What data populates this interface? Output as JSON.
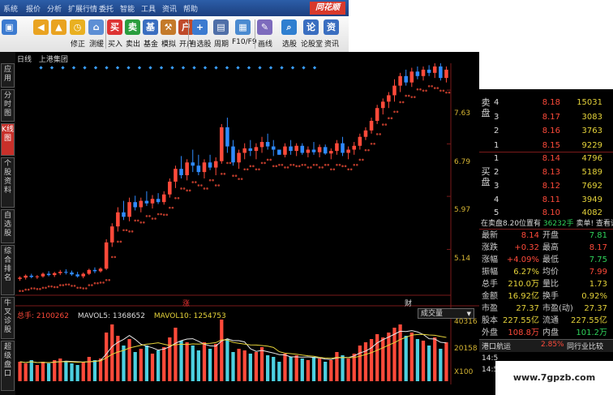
{
  "menubar": {
    "items": [
      "系统",
      "报价",
      "分析",
      "扩展行情",
      "委托",
      "智能",
      "工具",
      "资讯",
      "帮助"
    ],
    "brand": "同花顺"
  },
  "toolbar": {
    "buttons": [
      {
        "label": "",
        "icon": "back-icon"
      },
      {
        "label": "",
        "icon": "up-icon"
      },
      {
        "label": "修正",
        "icon": "fix-icon"
      },
      {
        "label": "测缓",
        "icon": "measure-icon"
      },
      {
        "label": "买入",
        "icon": "buy-icon"
      },
      {
        "label": "卖出",
        "icon": "sell-icon"
      },
      {
        "label": "基金",
        "icon": "fund-icon"
      },
      {
        "label": "模拟",
        "icon": "simulate-icon"
      },
      {
        "label": "开户",
        "icon": "open-account-icon"
      },
      {
        "label": "自选股",
        "icon": "watchlist-icon"
      },
      {
        "label": "周期",
        "icon": "period-icon"
      },
      {
        "label": "F10/F9",
        "icon": "f10-icon"
      },
      {
        "label": "画线",
        "icon": "draw-line-icon"
      },
      {
        "label": "选股",
        "icon": "stock-select-icon"
      },
      {
        "label": "论股堂",
        "icon": "forum-icon"
      },
      {
        "label": "资讯",
        "icon": "news-icon"
      }
    ]
  },
  "left_tabs": [
    {
      "label": "应用",
      "active": false
    },
    {
      "label": "分时图",
      "active": false
    },
    {
      "label": "K线图",
      "active": true
    },
    {
      "label": "个股资料",
      "active": false
    },
    {
      "label": "自选股",
      "active": false
    },
    {
      "label": "综合排名",
      "active": false
    },
    {
      "label": "牛叉诊股",
      "active": false
    },
    {
      "label": "超级盘口",
      "active": false
    }
  ],
  "chart_header": {
    "period": "日线",
    "stock": "上港集团"
  },
  "price_axis": [
    "7.63",
    "6.79",
    "5.97",
    "5.14"
  ],
  "markers": {
    "up": "涨",
    "fin": "财"
  },
  "volume": {
    "total_label": "总手: 2100262",
    "mavol5_label": "MAVOL5: 1368652",
    "mavol10_label": "MAVOL10: 1254753",
    "selector": "成交量",
    "axis": [
      "40316",
      "20158",
      "X100"
    ]
  },
  "colors": {
    "up": "#ff4a3a",
    "down": "#2f8bff",
    "yellow": "#e5d33a",
    "green": "#2fd35a",
    "grid": "#7a1a1a"
  },
  "chart_data": {
    "type": "candlestick",
    "title": "上港集团",
    "period": "日线",
    "y_ticks": [
      7.63,
      6.79,
      5.97,
      5.14
    ],
    "ylim": [
      4.45,
      8.05
    ],
    "candles": [
      [
        4.68,
        4.72,
        4.65,
        4.7
      ],
      [
        4.7,
        4.75,
        4.67,
        4.73
      ],
      [
        4.73,
        4.76,
        4.69,
        4.71
      ],
      [
        4.71,
        4.74,
        4.68,
        4.72
      ],
      [
        4.72,
        4.78,
        4.7,
        4.76
      ],
      [
        4.76,
        4.8,
        4.72,
        4.74
      ],
      [
        4.74,
        4.79,
        4.71,
        4.77
      ],
      [
        4.77,
        4.82,
        4.74,
        4.79
      ],
      [
        4.79,
        4.83,
        4.75,
        4.78
      ],
      [
        4.78,
        4.81,
        4.73,
        4.75
      ],
      [
        4.75,
        4.79,
        4.7,
        4.72
      ],
      [
        4.72,
        4.78,
        4.69,
        4.76
      ],
      [
        4.76,
        4.84,
        4.74,
        4.82
      ],
      [
        4.82,
        4.86,
        4.77,
        4.8
      ],
      [
        4.8,
        4.86,
        4.78,
        4.84
      ],
      [
        4.84,
        5.3,
        4.82,
        5.25
      ],
      [
        5.25,
        5.55,
        5.18,
        5.5
      ],
      [
        5.5,
        5.8,
        5.42,
        5.72
      ],
      [
        5.72,
        5.9,
        5.6,
        5.65
      ],
      [
        5.65,
        5.95,
        5.58,
        5.88
      ],
      [
        5.88,
        5.98,
        5.75,
        5.8
      ],
      [
        5.8,
        5.95,
        5.72,
        5.9
      ],
      [
        5.9,
        6.05,
        5.82,
        5.86
      ],
      [
        5.86,
        5.99,
        5.78,
        5.93
      ],
      [
        5.93,
        6.02,
        5.85,
        5.88
      ],
      [
        5.88,
        6.05,
        5.84,
        6.0
      ],
      [
        6.0,
        6.25,
        5.95,
        6.2
      ],
      [
        6.2,
        6.45,
        6.1,
        6.4
      ],
      [
        6.4,
        6.6,
        6.25,
        6.3
      ],
      [
        6.3,
        6.55,
        6.22,
        6.5
      ],
      [
        6.5,
        6.7,
        6.35,
        6.45
      ],
      [
        6.45,
        6.62,
        6.3,
        6.35
      ],
      [
        6.35,
        6.55,
        6.25,
        6.5
      ],
      [
        6.5,
        6.62,
        6.38,
        6.42
      ],
      [
        6.42,
        6.58,
        6.3,
        6.52
      ],
      [
        6.52,
        7.1,
        6.48,
        7.05
      ],
      [
        7.05,
        7.2,
        6.65,
        6.75
      ],
      [
        6.75,
        6.85,
        6.45,
        6.5
      ],
      [
        6.5,
        6.7,
        6.4,
        6.65
      ],
      [
        6.65,
        6.8,
        6.55,
        6.72
      ],
      [
        6.72,
        6.85,
        6.6,
        6.68
      ],
      [
        6.68,
        6.8,
        6.55,
        6.74
      ],
      [
        6.74,
        6.9,
        6.65,
        6.82
      ],
      [
        6.82,
        6.95,
        6.7,
        6.75
      ],
      [
        6.75,
        6.85,
        6.6,
        6.7
      ],
      [
        6.7,
        6.7,
        6.62,
        6.62
      ],
      [
        6.62,
        6.8,
        6.58,
        6.75
      ],
      [
        6.75,
        6.85,
        6.62,
        6.68
      ],
      [
        6.68,
        6.8,
        6.6,
        6.76
      ],
      [
        6.76,
        6.8,
        6.62,
        6.65
      ],
      [
        6.65,
        6.75,
        6.58,
        6.7
      ],
      [
        6.7,
        6.82,
        6.62,
        6.66
      ],
      [
        6.66,
        6.78,
        6.58,
        6.74
      ],
      [
        6.74,
        6.78,
        6.62,
        6.64
      ],
      [
        6.64,
        6.72,
        6.55,
        6.68
      ],
      [
        6.68,
        6.85,
        6.62,
        6.8
      ],
      [
        6.8,
        6.9,
        6.6,
        6.65
      ],
      [
        6.65,
        6.75,
        6.55,
        6.7
      ],
      [
        6.7,
        6.82,
        6.62,
        6.76
      ],
      [
        6.76,
        6.95,
        6.7,
        6.9
      ],
      [
        6.9,
        7.05,
        6.85,
        7.0
      ],
      [
        7.0,
        7.2,
        6.95,
        7.15
      ],
      [
        7.15,
        7.4,
        7.1,
        7.35
      ],
      [
        7.35,
        7.5,
        7.25,
        7.45
      ],
      [
        7.45,
        7.6,
        7.35,
        7.55
      ],
      [
        7.55,
        7.8,
        7.45,
        7.7
      ],
      [
        7.7,
        7.9,
        7.6,
        7.85
      ],
      [
        7.85,
        7.95,
        7.7,
        7.75
      ],
      [
        7.75,
        7.98,
        7.68,
        7.92
      ],
      [
        7.92,
        8.0,
        7.8,
        7.85
      ],
      [
        7.85,
        8.0,
        7.78,
        7.95
      ],
      [
        7.95,
        8.02,
        7.85,
        7.9
      ],
      [
        7.9,
        8.05,
        7.82,
        8.0
      ],
      [
        8.0,
        8.05,
        7.78,
        7.82
      ],
      [
        7.82,
        8.0,
        7.75,
        7.95
      ]
    ],
    "volume": [
      12,
      11,
      13,
      10,
      12,
      11,
      13,
      14,
      12,
      11,
      10,
      12,
      15,
      13,
      14,
      30,
      35,
      28,
      22,
      26,
      18,
      20,
      22,
      17,
      19,
      21,
      27,
      33,
      25,
      24,
      22,
      19,
      24,
      20,
      23,
      38,
      26,
      18,
      20,
      19,
      17,
      18,
      21,
      16,
      15,
      12,
      17,
      15,
      16,
      14,
      13,
      15,
      14,
      12,
      13,
      18,
      16,
      14,
      17,
      22,
      24,
      26,
      29,
      27,
      30,
      33,
      35,
      28,
      30,
      26,
      25,
      22,
      27,
      20,
      24
    ],
    "mavol5": 1368652,
    "mavol10": 1254753,
    "total_volume": 2100262
  },
  "orderbook": {
    "sell_label": "卖盘",
    "buy_label": "买盘",
    "sell": [
      {
        "level": "4",
        "price": "8.18",
        "vol": "15031"
      },
      {
        "level": "3",
        "price": "8.17",
        "vol": "3083"
      },
      {
        "level": "2",
        "price": "8.16",
        "vol": "3763"
      },
      {
        "level": "1",
        "price": "8.15",
        "vol": "9229"
      }
    ],
    "buy": [
      {
        "level": "1",
        "price": "8.14",
        "vol": "4796"
      },
      {
        "level": "2",
        "price": "8.13",
        "vol": "5189"
      },
      {
        "level": "3",
        "price": "8.12",
        "vol": "7692"
      },
      {
        "level": "4",
        "price": "8.11",
        "vol": "3949"
      },
      {
        "level": "5",
        "price": "8.10",
        "vol": "4082"
      }
    ]
  },
  "sellinfo": {
    "text": "在卖盘8.20位置有",
    "qty": "36232手",
    "tail": "卖单! 查看详细"
  },
  "stats": [
    {
      "k": "最新",
      "v": "8.14",
      "k2": "开盘",
      "v2": "7.81"
    },
    {
      "k": "涨跌",
      "v": "+0.32",
      "k2": "最高",
      "v2": "8.17"
    },
    {
      "k": "涨幅",
      "v": "+4.09%",
      "k2": "最低",
      "v2": "7.75"
    },
    {
      "k": "振幅",
      "v": "6.27%",
      "k2": "均价",
      "v2": "7.99"
    },
    {
      "k": "总手",
      "v": "210.0万",
      "k2": "量比",
      "v2": "1.73"
    },
    {
      "k": "金额",
      "v": "16.92亿",
      "k2": "换手",
      "v2": "0.92%"
    },
    {
      "k": "市盈",
      "v": "27.37",
      "k2": "市盈(动)",
      "v2": "27.37"
    },
    {
      "k": "股本",
      "v": "227.55亿",
      "k2": "流通",
      "v2": "227.55亿"
    },
    {
      "k": "外盘",
      "v": "108.8万",
      "k2": "内盘",
      "v2": "101.2万"
    }
  ],
  "bottom": {
    "sector": "港口航运",
    "sector_change": "2.85%",
    "compare": "同行业比较",
    "time1": "14:5",
    "time2": "14:5"
  },
  "watermark": "www.7gpzb.com"
}
